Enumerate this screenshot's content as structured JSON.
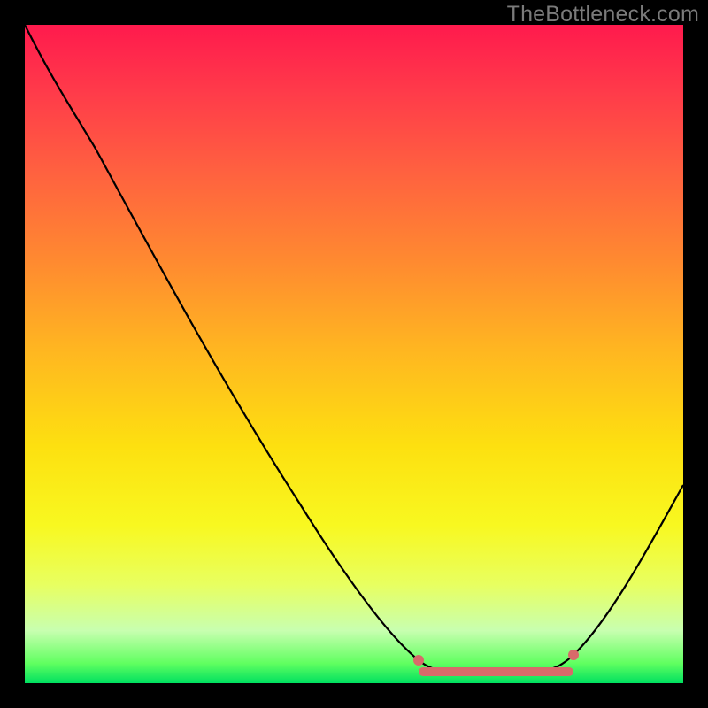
{
  "watermark": "TheBottleneck.com",
  "chart_data": {
    "type": "line",
    "title": "",
    "xlabel": "",
    "ylabel": "",
    "xlim": [
      0,
      100
    ],
    "ylim": [
      0,
      100
    ],
    "series": [
      {
        "name": "bottleneck-curve",
        "x": [
          0,
          6,
          12,
          18,
          24,
          30,
          36,
          42,
          48,
          54,
          58,
          62,
          66,
          70,
          74,
          78,
          82,
          86,
          90,
          94,
          98,
          100
        ],
        "y": [
          100,
          94,
          85,
          76,
          67,
          58,
          49,
          40,
          31,
          22,
          16,
          11,
          6,
          3,
          2,
          2,
          3,
          6,
          12,
          20,
          30,
          36
        ]
      },
      {
        "name": "flat-bottom-marker",
        "x": [
          60,
          80
        ],
        "y": [
          2,
          2
        ]
      }
    ],
    "gradient_stops": [
      {
        "pos": 0.0,
        "color": "#ff1a4d"
      },
      {
        "pos": 0.1,
        "color": "#ff3a4a"
      },
      {
        "pos": 0.22,
        "color": "#ff6040"
      },
      {
        "pos": 0.36,
        "color": "#ff8a30"
      },
      {
        "pos": 0.5,
        "color": "#ffb820"
      },
      {
        "pos": 0.64,
        "color": "#fde010"
      },
      {
        "pos": 0.76,
        "color": "#f8f820"
      },
      {
        "pos": 0.85,
        "color": "#e8ff60"
      },
      {
        "pos": 0.92,
        "color": "#c8ffb0"
      },
      {
        "pos": 0.97,
        "color": "#60ff60"
      },
      {
        "pos": 1.0,
        "color": "#00e060"
      }
    ],
    "marker_color": "#d86a6a"
  }
}
